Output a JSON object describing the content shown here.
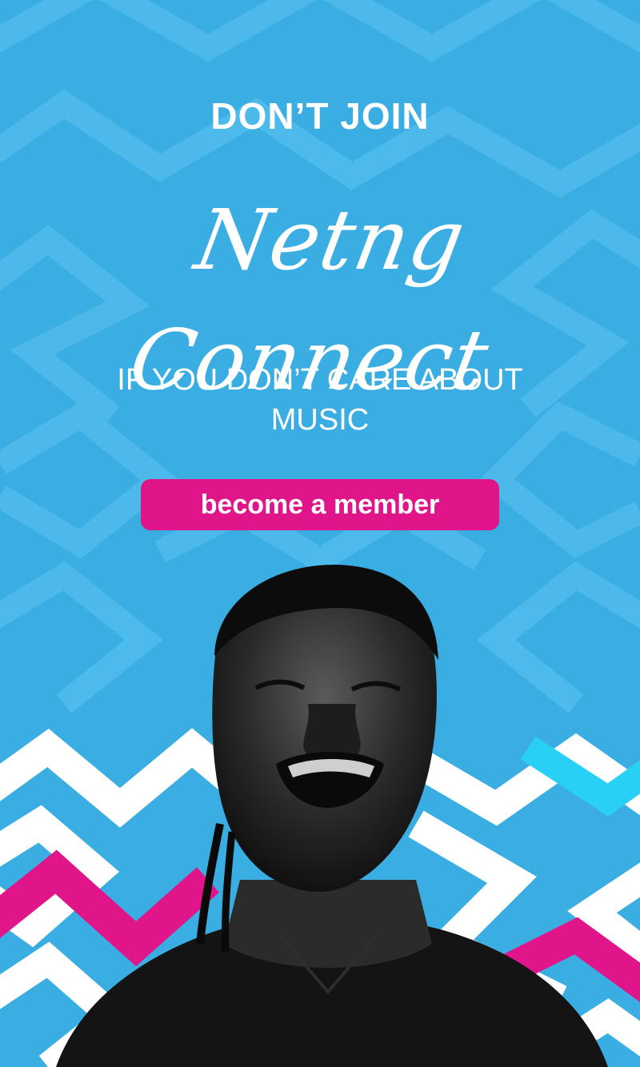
{
  "promo": {
    "headline": "DON’T JOIN",
    "brand": "Netng Connect",
    "subline_1": "IF YOU DON’T CARE ABOUT",
    "subline_2": "MUSIC",
    "cta_label": "become a member"
  },
  "colors": {
    "background": "#3aaee3",
    "pattern_light": "#4fbbeb",
    "accent_pink": "#e0158a",
    "accent_cyan": "#29d0f5",
    "text": "#ffffff"
  },
  "icons": {
    "photo": "portrait-photo"
  }
}
